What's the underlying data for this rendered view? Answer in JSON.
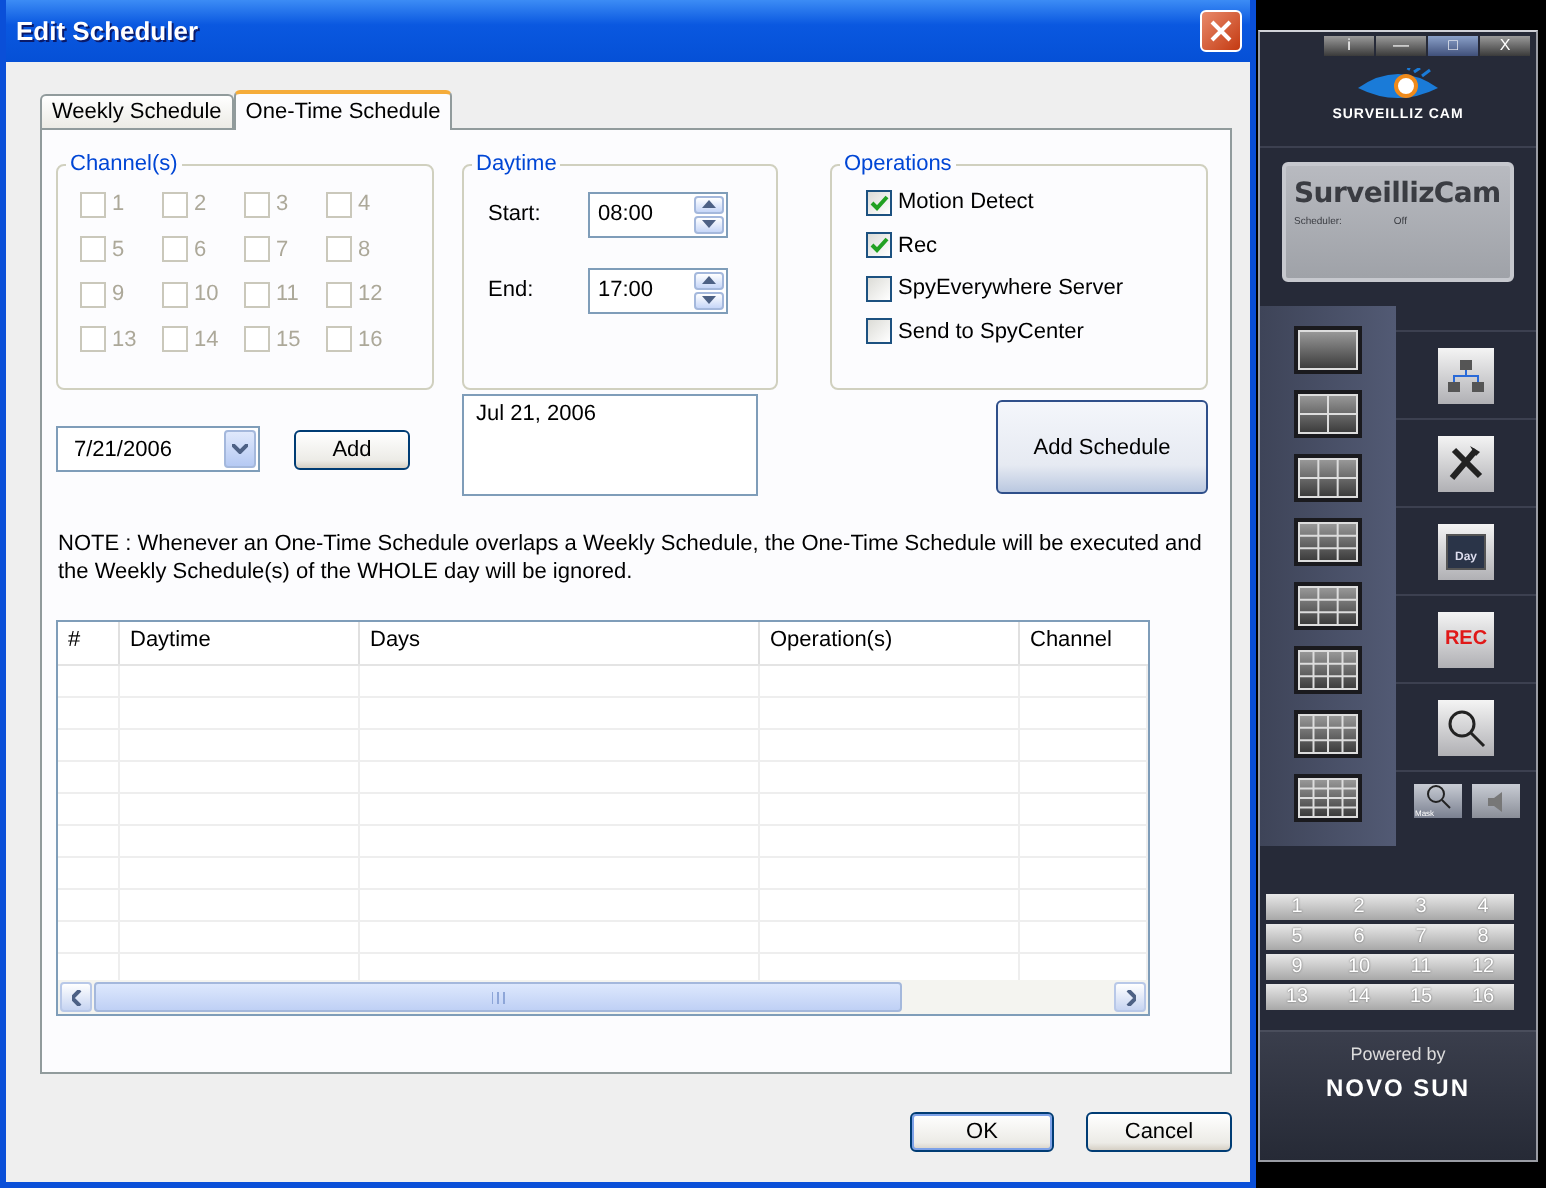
{
  "window": {
    "title": "Edit Scheduler"
  },
  "tabs": [
    {
      "label": "Weekly Schedule",
      "selected": false
    },
    {
      "label": "One-Time Schedule",
      "selected": true
    }
  ],
  "channels": {
    "title": "Channel(s)",
    "items": [
      {
        "label": "1",
        "checked": false,
        "disabled": true
      },
      {
        "label": "2",
        "checked": false,
        "disabled": true
      },
      {
        "label": "3",
        "checked": false,
        "disabled": true
      },
      {
        "label": "4",
        "checked": false,
        "disabled": true
      },
      {
        "label": "5",
        "checked": false,
        "disabled": true
      },
      {
        "label": "6",
        "checked": false,
        "disabled": true
      },
      {
        "label": "7",
        "checked": false,
        "disabled": true
      },
      {
        "label": "8",
        "checked": false,
        "disabled": true
      },
      {
        "label": "9",
        "checked": false,
        "disabled": true
      },
      {
        "label": "10",
        "checked": false,
        "disabled": true
      },
      {
        "label": "11",
        "checked": false,
        "disabled": true
      },
      {
        "label": "12",
        "checked": false,
        "disabled": true
      },
      {
        "label": "13",
        "checked": false,
        "disabled": true
      },
      {
        "label": "14",
        "checked": false,
        "disabled": true
      },
      {
        "label": "15",
        "checked": false,
        "disabled": true
      },
      {
        "label": "16",
        "checked": false,
        "disabled": true
      }
    ]
  },
  "daytime": {
    "title": "Daytime",
    "start": {
      "label": "Start:",
      "value": "08:00"
    },
    "end": {
      "label": "End:",
      "value": "17:00"
    }
  },
  "operations": {
    "title": "Operations",
    "items": [
      {
        "label": "Motion Detect",
        "checked": true
      },
      {
        "label": "Rec",
        "checked": true
      },
      {
        "label": "SpyEverywhere Server",
        "checked": false
      },
      {
        "label": "Send to SpyCenter",
        "checked": false
      }
    ]
  },
  "date_picker": {
    "value": "7/21/2006"
  },
  "add_button": "Add",
  "dates_list": [
    "Jul 21, 2006"
  ],
  "add_schedule_button": "Add Schedule",
  "note": "NOTE :  Whenever an One-Time Schedule overlaps a Weekly Schedule, the One-Time Schedule will be executed and the Weekly Schedule(s) of the WHOLE day will be ignored.",
  "table": {
    "columns": [
      "#",
      "Daytime",
      "Days",
      "Operation(s)",
      "Channel"
    ]
  },
  "buttons": [
    "OK",
    "Cancel"
  ],
  "camera_panel": {
    "window_buttons": [
      "i",
      "—",
      "□",
      "X"
    ],
    "logo": "SURVEILLIZ CAM",
    "name": "SurveillizCam",
    "status_label": "Scheduler:",
    "status_value": "Off",
    "rec_label": "REC",
    "day_label": "Day",
    "mask_label": "Mask",
    "channel_buttons": [
      "1",
      "2",
      "3",
      "4",
      "5",
      "6",
      "7",
      "8",
      "9",
      "10",
      "11",
      "12",
      "13",
      "14",
      "15",
      "16"
    ],
    "powered_by": "Powered by",
    "brand": "NOVO SUN"
  }
}
